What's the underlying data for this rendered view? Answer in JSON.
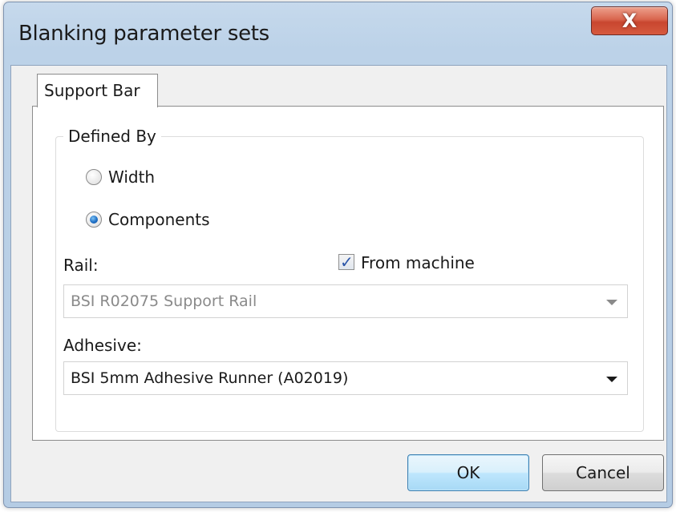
{
  "window": {
    "title": "Blanking parameter sets",
    "close_glyph": "X"
  },
  "tabs": [
    {
      "label": "Support Bar",
      "selected": true
    }
  ],
  "defined_by": {
    "legend": "Defined By",
    "options": [
      {
        "label": "Width",
        "selected": false
      },
      {
        "label": "Components",
        "selected": true
      }
    ]
  },
  "rail": {
    "label": "Rail:",
    "from_machine_label": "From machine",
    "from_machine_checked": true,
    "value": "BSI R02075 Support Rail",
    "disabled": true
  },
  "adhesive": {
    "label": "Adhesive:",
    "value": "BSI 5mm Adhesive Runner (A02019)"
  },
  "buttons": {
    "ok": "OK",
    "cancel": "Cancel"
  },
  "colors": {
    "disabled_text": "#8a8a8a",
    "text": "#1a1a1a",
    "chrome": "#bcd2e8",
    "close_button": "#c8462f",
    "default_button_border": "#3c7fb1"
  },
  "icons": {
    "close": "close-icon",
    "check": "check-icon",
    "dropdown": "chevron-down-icon"
  }
}
